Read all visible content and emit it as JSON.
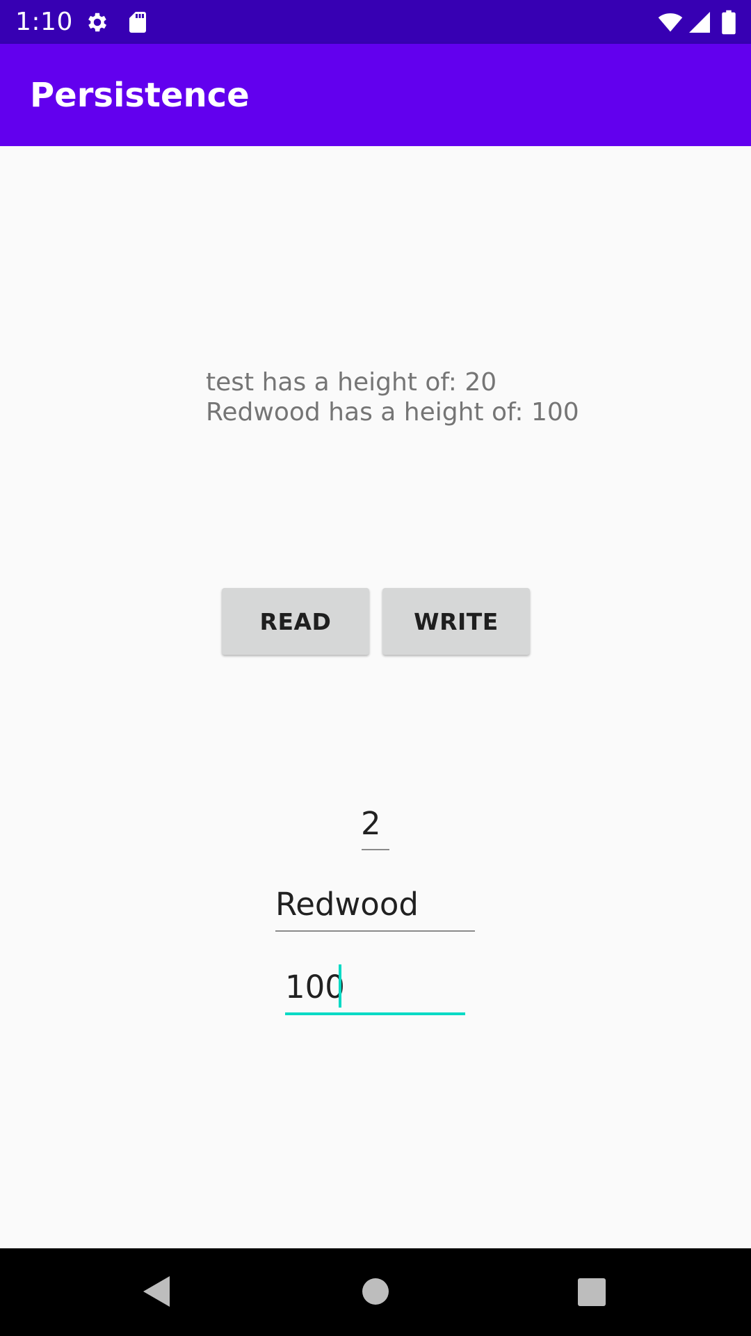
{
  "status_bar": {
    "time": "1:10",
    "icons": [
      "gear-icon",
      "sd-card-icon",
      "wifi-icon",
      "cell-signal-icon",
      "battery-icon"
    ]
  },
  "app_bar": {
    "title": "Persistence",
    "color": "#6200EE",
    "status_color": "#3700B3"
  },
  "output": {
    "lines": [
      "test has a height of: 20",
      "Redwood has a height of: 100"
    ]
  },
  "buttons": {
    "read_label": "READ",
    "write_label": "WRITE"
  },
  "fields": {
    "id_value": "2",
    "name_value": "Redwood",
    "height_value": "100"
  },
  "accent_color": "#03DAC5",
  "nav_bar": {
    "icons": [
      "back-icon",
      "home-icon",
      "recents-icon"
    ]
  }
}
